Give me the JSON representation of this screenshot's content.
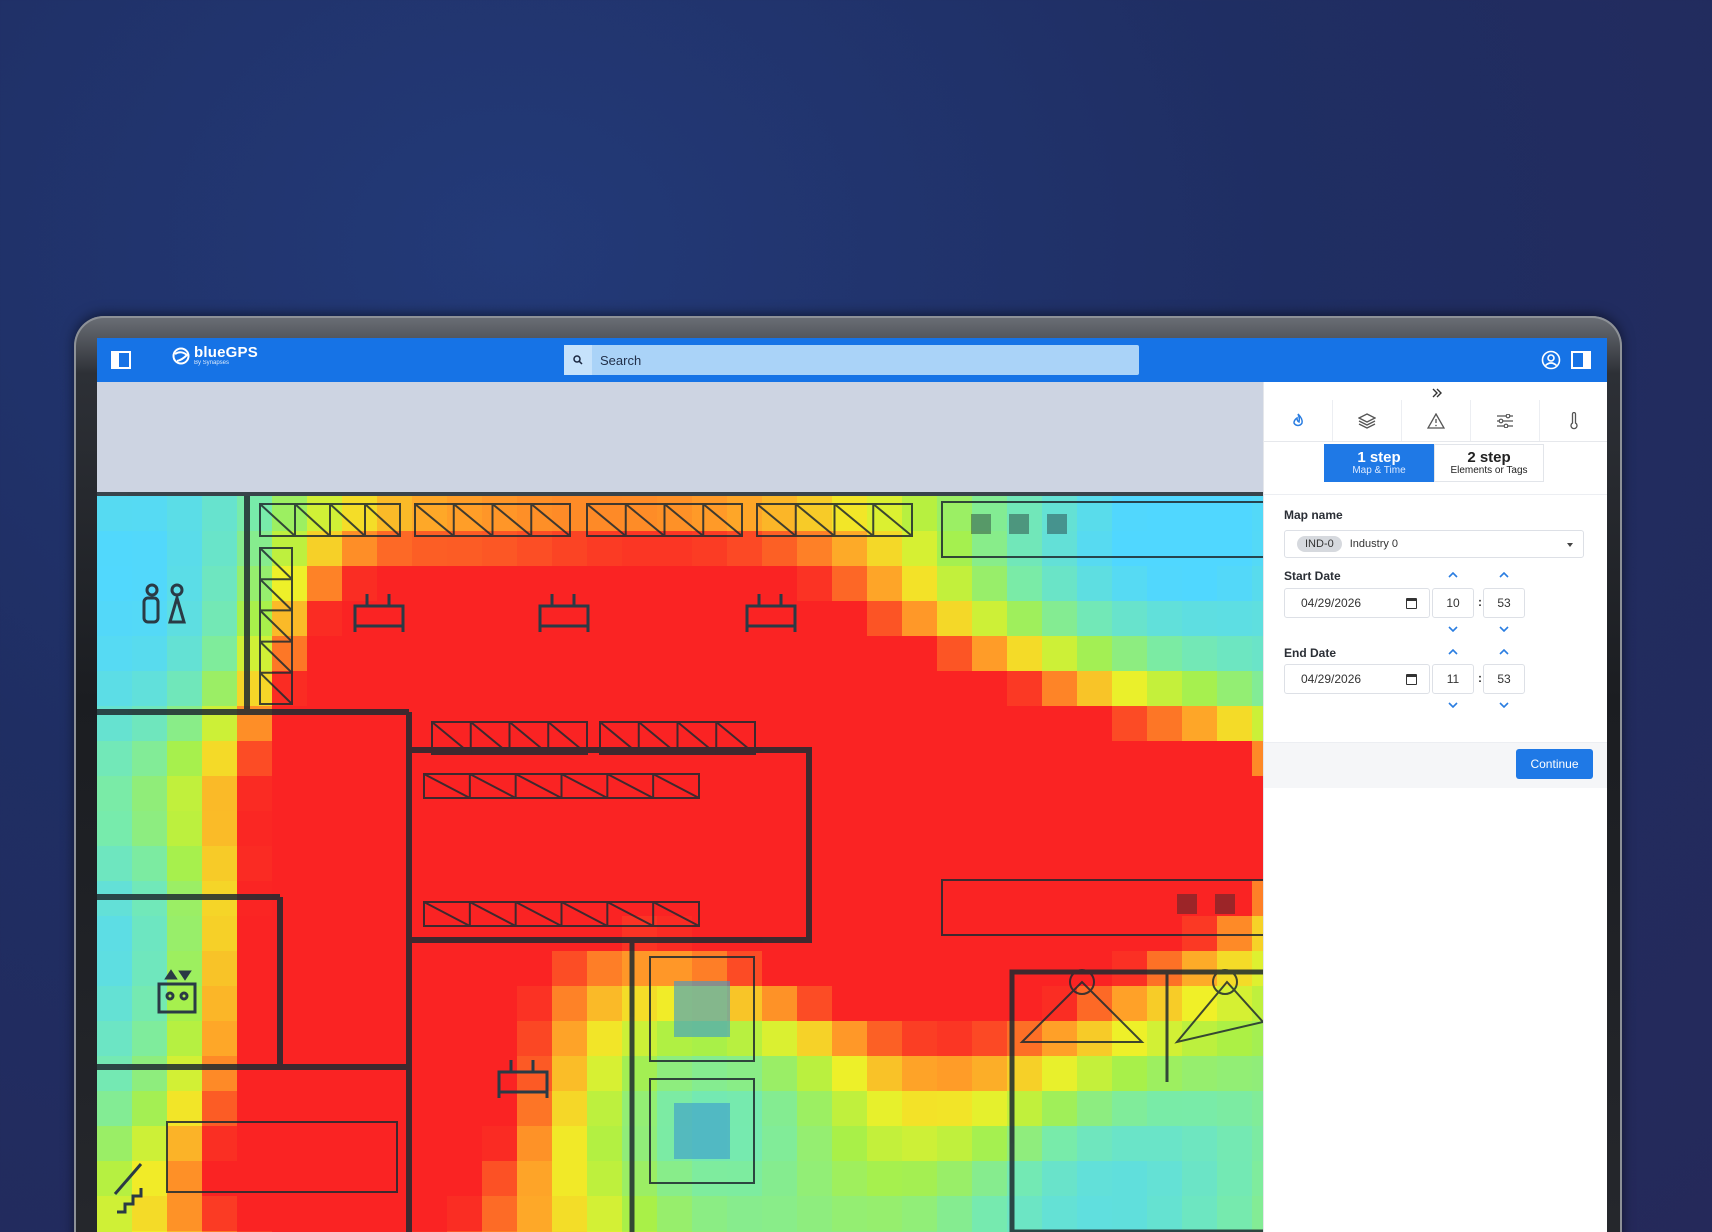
{
  "app": {
    "brand": "blueGPS",
    "brand_sub": "By Synapses"
  },
  "search": {
    "placeholder": "Search",
    "value": ""
  },
  "icons": {
    "sidebar_toggle": "sidebar-left-icon",
    "search": "search-icon",
    "user": "user-circle-icon",
    "panel_toggle": "sidebar-right-icon",
    "collapse": "double-chevron-right-icon",
    "tabs": [
      "heat-flame-icon",
      "layers-icon",
      "warning-triangle-icon",
      "sliders-icon",
      "thermometer-icon"
    ]
  },
  "steps": [
    {
      "title": "1 step",
      "subtitle": "Map & Time",
      "active": true
    },
    {
      "title": "2 step",
      "subtitle": "Elements or Tags",
      "active": false
    }
  ],
  "form": {
    "map_name_label": "Map name",
    "map_badge": "IND-0",
    "map_value": "Industry 0",
    "start_date_label": "Start Date",
    "start_date": "04/29/2026",
    "start_hour": "10",
    "start_minute": "53",
    "end_date_label": "End Date",
    "end_date": "04/29/2026",
    "end_hour": "11",
    "end_minute": "53",
    "time_separator": ":",
    "continue_label": "Continue"
  },
  "colors": {
    "topbar": "#1673e6",
    "search_bg": "#aad3f8",
    "accent": "#1f79e6",
    "heat_low": "#4fd9ff",
    "heat_mid": "#a8f048",
    "heat_high": "#ff2a2a"
  }
}
